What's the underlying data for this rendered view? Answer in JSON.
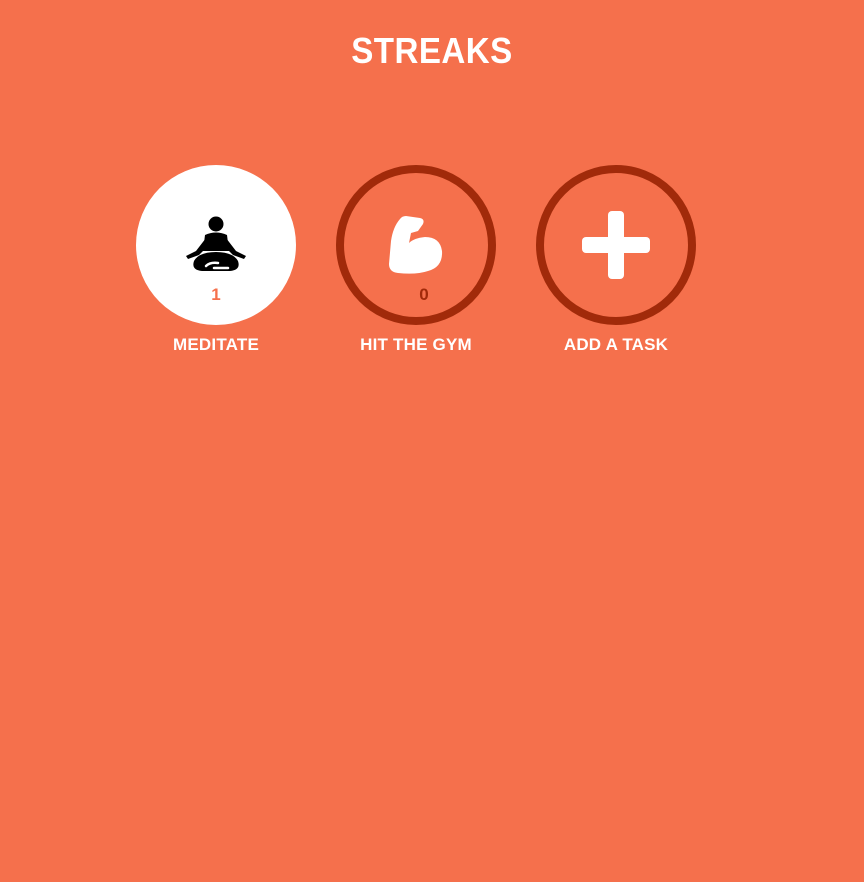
{
  "header": {
    "title": "STREAKS"
  },
  "colors": {
    "background": "#f5704c",
    "ring": "#a12a0a",
    "complete_fill": "#ffffff"
  },
  "tasks": [
    {
      "label": "MEDITATE",
      "count": "1",
      "icon": "meditation-icon",
      "state": "complete"
    },
    {
      "label": "HIT THE GYM",
      "count": "0",
      "icon": "flexed-biceps-icon",
      "state": "incomplete"
    },
    {
      "label": "ADD A TASK",
      "icon": "plus-icon",
      "state": "add"
    }
  ]
}
